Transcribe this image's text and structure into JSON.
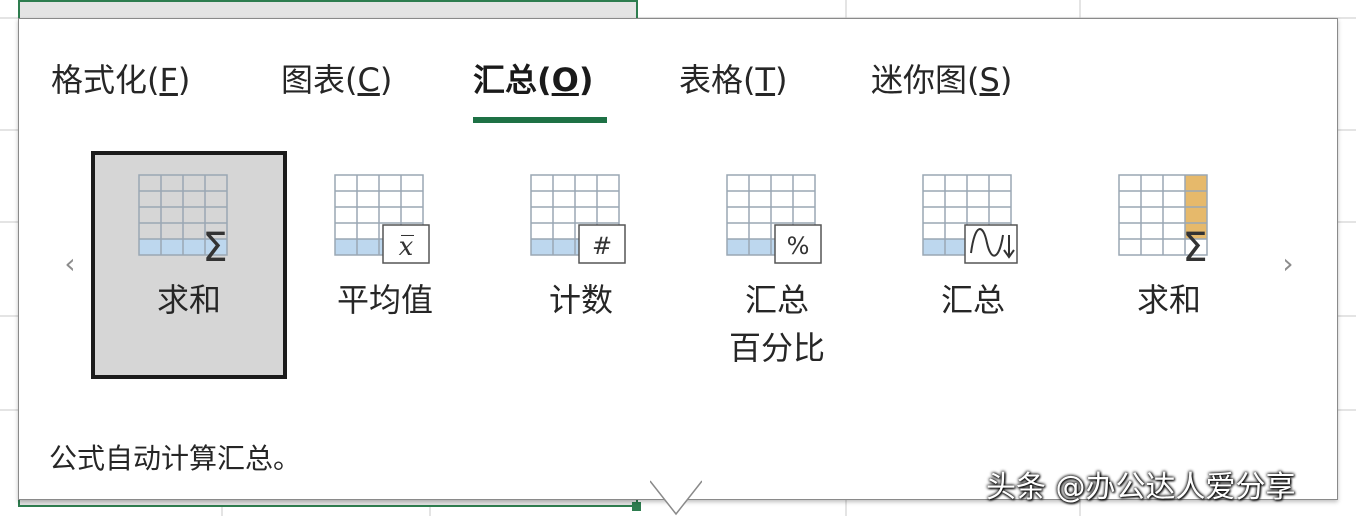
{
  "tabs": [
    {
      "label": "格式化(",
      "key": "F",
      "close": ")"
    },
    {
      "label": "图表(",
      "key": "C",
      "close": ")"
    },
    {
      "label": "汇总(",
      "key": "O",
      "close": ")"
    },
    {
      "label": "表格(",
      "key": "T",
      "close": ")"
    },
    {
      "label": "迷你图(",
      "key": "S",
      "close": ")"
    }
  ],
  "active_tab": "汇总(O)",
  "items": [
    {
      "line1": "求和",
      "line2": "",
      "icon": "sum-row-icon",
      "symbol": "Σ"
    },
    {
      "line1": "平均值",
      "line2": "",
      "icon": "average-icon",
      "symbol": "x̅"
    },
    {
      "line1": "计数",
      "line2": "",
      "icon": "count-icon",
      "symbol": "#"
    },
    {
      "line1": "汇总",
      "line2": "百分比",
      "icon": "percent-total-icon",
      "symbol": "%"
    },
    {
      "line1": "汇总",
      "line2": "",
      "icon": "running-total-icon",
      "symbol": ""
    },
    {
      "line1": "求和",
      "line2": "",
      "icon": "sum-column-icon",
      "symbol": "Σ"
    }
  ],
  "nav": {
    "prev": "‹",
    "next": "›"
  },
  "description": "公式自动计算汇总。",
  "watermark": "头条 @办公达人爱分享",
  "colors": {
    "accent": "#1e7145",
    "highlight_row": "#bdd7ee",
    "highlight_col": "#e6b96b",
    "selected_bg": "#d6d6d6"
  }
}
